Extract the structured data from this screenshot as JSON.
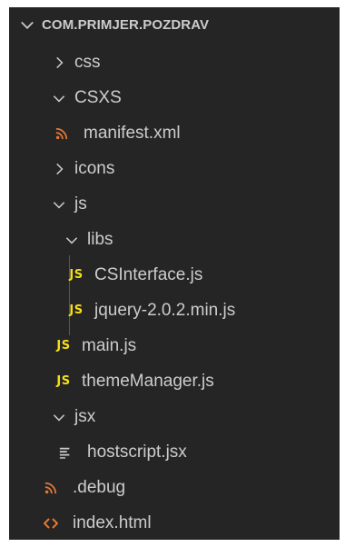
{
  "explorer": {
    "title": "COM.PRIMJER.POZDRAV",
    "items": [
      {
        "label": "css",
        "kind": "folder",
        "state": "collapsed",
        "icon": "chevron-right-icon"
      },
      {
        "label": "CSXS",
        "kind": "folder",
        "state": "expanded",
        "icon": "chevron-down-icon"
      },
      {
        "label": "manifest.xml",
        "kind": "file",
        "icon": "rss-icon"
      },
      {
        "label": "icons",
        "kind": "folder",
        "state": "collapsed",
        "icon": "chevron-right-icon"
      },
      {
        "label": "js",
        "kind": "folder",
        "state": "expanded",
        "icon": "chevron-down-icon"
      },
      {
        "label": "libs",
        "kind": "folder",
        "state": "expanded",
        "icon": "chevron-down-icon"
      },
      {
        "label": "CSInterface.js",
        "kind": "file",
        "icon": "js-icon"
      },
      {
        "label": "jquery-2.0.2.min.js",
        "kind": "file",
        "icon": "js-icon"
      },
      {
        "label": "main.js",
        "kind": "file",
        "icon": "js-icon"
      },
      {
        "label": "themeManager.js",
        "kind": "file",
        "icon": "js-icon"
      },
      {
        "label": "jsx",
        "kind": "folder",
        "state": "expanded",
        "icon": "chevron-down-icon"
      },
      {
        "label": "hostscript.jsx",
        "kind": "file",
        "icon": "lines-icon"
      },
      {
        "label": ".debug",
        "kind": "file",
        "icon": "rss-icon"
      },
      {
        "label": "index.html",
        "kind": "file",
        "icon": "code-brackets-icon"
      }
    ],
    "js_badge": "JS",
    "colors": {
      "background": "#252526",
      "text": "#cccccc",
      "js_badge": "#f5de19",
      "rss": "#e37933",
      "html_brackets": "#e37933",
      "indent_guide": "#585858"
    }
  }
}
